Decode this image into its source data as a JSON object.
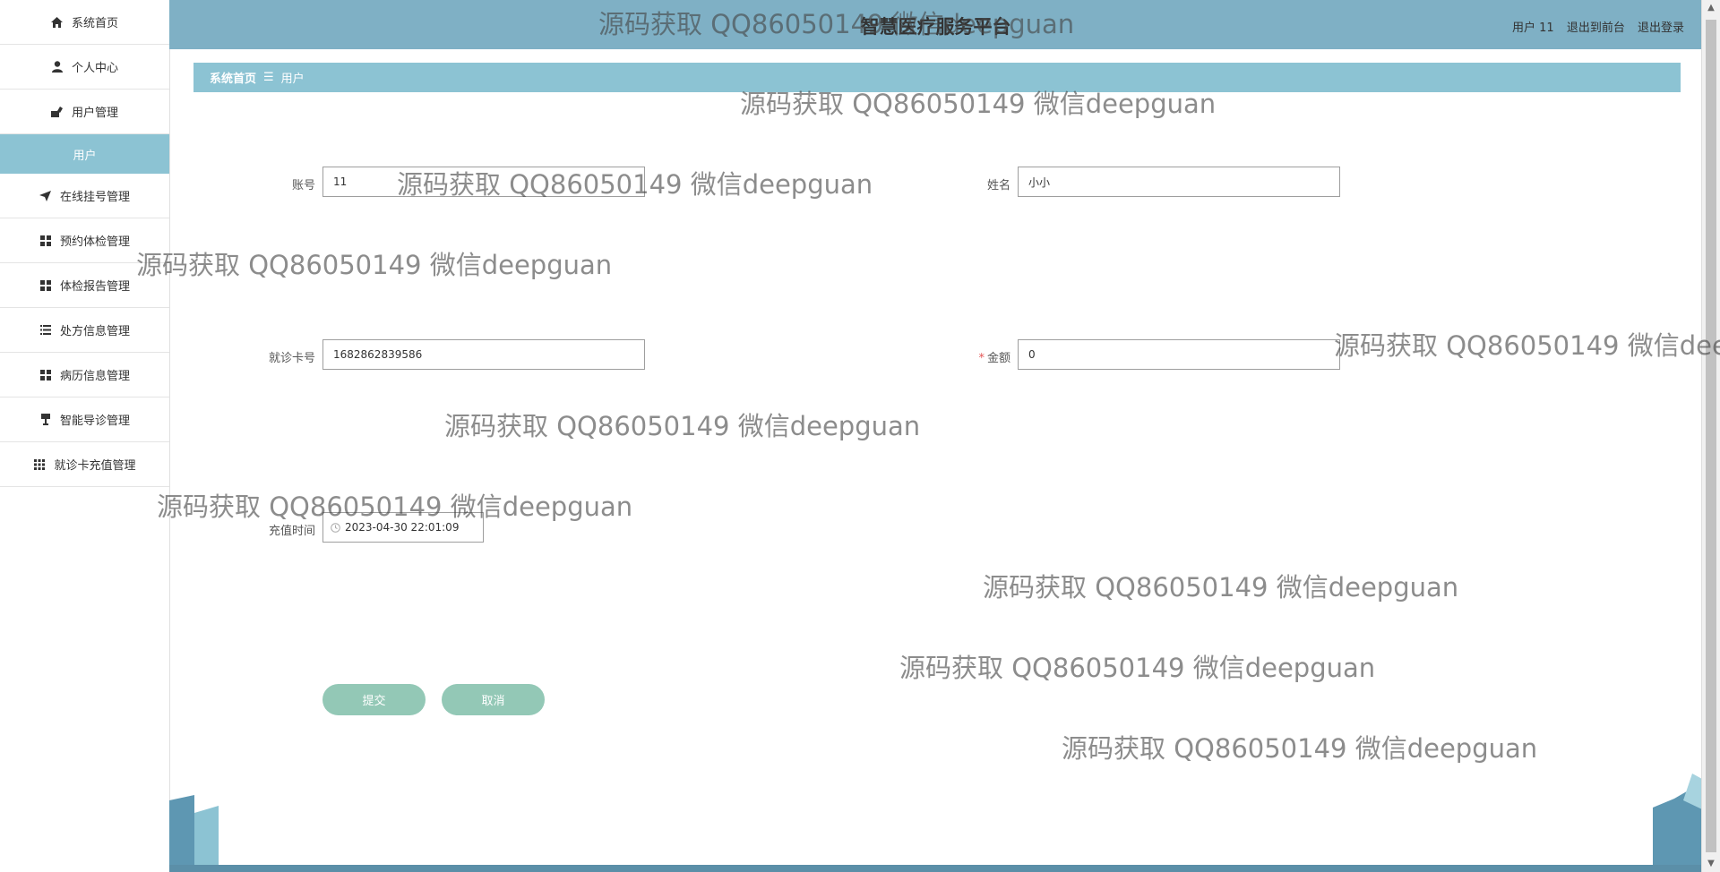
{
  "header": {
    "title": "智慧医疗服务平台",
    "user_label": "用户 11",
    "back_front": "退出到前台",
    "logout": "退出登录"
  },
  "sidebar": {
    "items": [
      {
        "label": "系统首页",
        "icon": "home-icon"
      },
      {
        "label": "个人中心",
        "icon": "user-icon"
      },
      {
        "label": "用户管理",
        "icon": "user-admin-icon"
      },
      {
        "label": "用户",
        "icon": ""
      },
      {
        "label": "在线挂号管理",
        "icon": "send-icon"
      },
      {
        "label": "预约体检管理",
        "icon": "grid-icon"
      },
      {
        "label": "体检报告管理",
        "icon": "grid-icon"
      },
      {
        "label": "处方信息管理",
        "icon": "list-icon"
      },
      {
        "label": "病历信息管理",
        "icon": "grid-icon"
      },
      {
        "label": "智能导诊管理",
        "icon": "flag-icon"
      },
      {
        "label": "就诊卡充值管理",
        "icon": "apps-icon"
      }
    ]
  },
  "breadcrumb": {
    "home": "系统首页",
    "sep": "☰",
    "current": "用户"
  },
  "form": {
    "account_label": "账号",
    "account_value": "11",
    "name_label": "姓名",
    "name_value": "小小",
    "card_label": "就诊卡号",
    "card_value": "1682862839586",
    "amount_required": "*",
    "amount_label": "金额",
    "amount_value": "0",
    "time_label": "充值时间",
    "time_value": "2023-04-30 22:01:09",
    "submit": "提交",
    "cancel": "取消"
  },
  "watermark": "源码获取 QQ86050149 微信deepguan",
  "colors": {
    "header": "#7fb0c5",
    "breadcrumb": "#8cc3d3",
    "button": "#93c8b6",
    "active_sidebar": "#8cc3d3"
  }
}
